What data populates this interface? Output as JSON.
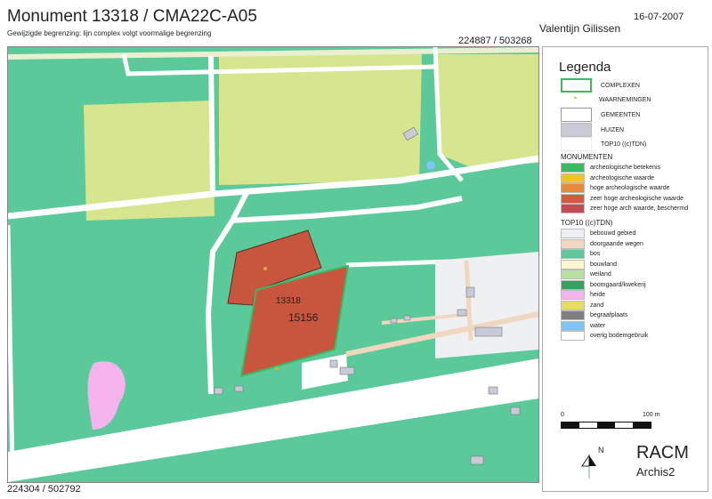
{
  "header": {
    "title": "Monument 13318 / CMA22C-A05",
    "subtitle": "Gewijzigde begrenzing: lijn complex volgt voormalige begrenzing",
    "date": "16-07-2007",
    "author": "Valentijn Gilissen",
    "coord_top_right": "224887 / 503268",
    "coord_bottom_left": "224304 / 502792"
  },
  "map": {
    "labels": [
      "13318",
      "15156"
    ]
  },
  "legend": {
    "title": "Legenda",
    "items": [
      {
        "label": "COMPLEXEN"
      },
      {
        "label": "WAARNEMINGEN"
      },
      {
        "label": "GEMEENTEN"
      },
      {
        "label": "HUIZEN"
      },
      {
        "label": "TOP10 ((c)TDN)"
      }
    ],
    "monumenten_title": "MONUMENTEN",
    "monumenten": [
      {
        "label": "archeologische betekenis",
        "color": "#3cb860"
      },
      {
        "label": "archeologische waarde",
        "color": "#f5c22a"
      },
      {
        "label": "hoge archeologische waarde",
        "color": "#e88a3a"
      },
      {
        "label": "zeer hoge archeologische waarde",
        "color": "#d45a3e"
      },
      {
        "label": "zeer hoge arch waarde, beschermd",
        "color": "#c84850"
      }
    ],
    "top10_title": "TOP10 ((c)TDN)",
    "top10": [
      {
        "label": "bebouwd gebied",
        "color": "#eef0f2"
      },
      {
        "label": "doorgaande wegen",
        "color": "#f0d8c0"
      },
      {
        "label": "bos",
        "color": "#5cc99b"
      },
      {
        "label": "bouwland",
        "color": "#fbf7cf"
      },
      {
        "label": "weiland",
        "color": "#b8e0a0"
      },
      {
        "label": "boomgaard/kwekerij",
        "color": "#3aa060"
      },
      {
        "label": "heide",
        "color": "#f6b4ee"
      },
      {
        "label": "zand",
        "color": "#e6dc60"
      },
      {
        "label": "begraafplaats",
        "color": "#808080"
      },
      {
        "label": "water",
        "color": "#7ec4f4"
      },
      {
        "label": "overig bodemgebruik",
        "color": "#ffffff"
      }
    ],
    "scale": {
      "start": "0",
      "end": "100 m"
    },
    "north": "N",
    "org": "RACM",
    "system": "Archis2"
  }
}
